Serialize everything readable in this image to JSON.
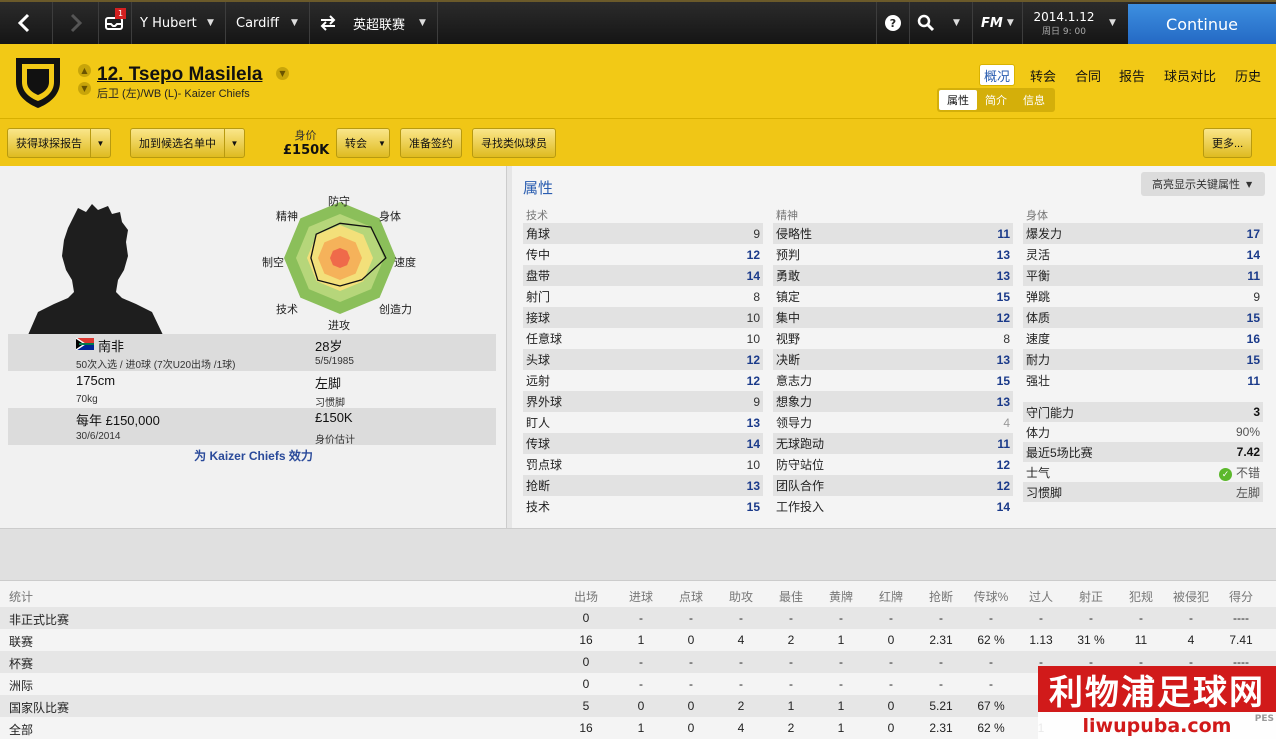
{
  "topbar": {
    "back_icon": "arrow-left-icon",
    "forward_icon": "arrow-right-icon",
    "inbox_badge": "1",
    "manager": "Y Hubert",
    "club": "Cardiff",
    "competition": "英超联赛",
    "logo": "FM",
    "date": "2014.1.12",
    "time": "周日 9: 00",
    "continue": "Continue"
  },
  "header": {
    "player_name": "12. Tsepo Masilela",
    "position": "后卫 (左)/WB (L)- Kaizer Chiefs",
    "tabs": [
      "概况",
      "转会",
      "合同",
      "报告",
      "球员对比",
      "历史"
    ],
    "subtabs": [
      "属性",
      "简介",
      "信息"
    ]
  },
  "actions": {
    "scout": "获得球探报告",
    "shortlist": "加到候选名单中",
    "value_label": "身价",
    "value": "£150K",
    "transfer": "转会",
    "contract": "准备签约",
    "similar": "寻找类似球员",
    "more": "更多..."
  },
  "radar": {
    "labels": [
      "防守",
      "身体",
      "速度",
      "创造力",
      "进攻",
      "技术",
      "制空",
      "精神"
    ],
    "colors": [
      "#8bbf5a",
      "#b6d67a",
      "#f3e07a",
      "#f5b25a",
      "#ef6a4a"
    ]
  },
  "profile": {
    "nation": "南非",
    "nation_flag": "south-africa-flag",
    "caps": "50次入选 / 进0球 (7次U20出场 /1球)",
    "age": "28岁",
    "dob": "5/5/1985",
    "height": "175cm",
    "foot": "左脚",
    "weight": "70kg",
    "foot_label": "习惯脚",
    "wage": "每年 £150,000",
    "value": "£150K",
    "contract_end": "30/6/2014",
    "value_label": "身价估计",
    "plays_for": "为 Kaizer Chiefs 效力"
  },
  "attributes": {
    "title": "属性",
    "highlight": "高亮显示关键属性",
    "technical_head": "技术",
    "technical": [
      {
        "name": "角球",
        "value": "9"
      },
      {
        "name": "传中",
        "value": "12"
      },
      {
        "name": "盘带",
        "value": "14"
      },
      {
        "name": "射门",
        "value": "8"
      },
      {
        "name": "接球",
        "value": "10"
      },
      {
        "name": "任意球",
        "value": "10"
      },
      {
        "name": "头球",
        "value": "12"
      },
      {
        "name": "远射",
        "value": "12"
      },
      {
        "name": "界外球",
        "value": "9"
      },
      {
        "name": "盯人",
        "value": "13"
      },
      {
        "name": "传球",
        "value": "14"
      },
      {
        "name": "罚点球",
        "value": "10"
      },
      {
        "name": "抢断",
        "value": "13"
      },
      {
        "name": "技术",
        "value": "15"
      }
    ],
    "mental_head": "精神",
    "mental": [
      {
        "name": "侵略性",
        "value": "11"
      },
      {
        "name": "预判",
        "value": "13"
      },
      {
        "name": "勇敢",
        "value": "13"
      },
      {
        "name": "镇定",
        "value": "15"
      },
      {
        "name": "集中",
        "value": "12"
      },
      {
        "name": "视野",
        "value": "8"
      },
      {
        "name": "决断",
        "value": "13"
      },
      {
        "name": "意志力",
        "value": "15"
      },
      {
        "name": "想象力",
        "value": "13"
      },
      {
        "name": "领导力",
        "value": "4"
      },
      {
        "name": "无球跑动",
        "value": "11"
      },
      {
        "name": "防守站位",
        "value": "12"
      },
      {
        "name": "团队合作",
        "value": "12"
      },
      {
        "name": "工作投入",
        "value": "14"
      }
    ],
    "physical_head": "身体",
    "physical": [
      {
        "name": "爆发力",
        "value": "17"
      },
      {
        "name": "灵活",
        "value": "14"
      },
      {
        "name": "平衡",
        "value": "11"
      },
      {
        "name": "弹跳",
        "value": "9"
      },
      {
        "name": "体质",
        "value": "15"
      },
      {
        "name": "速度",
        "value": "16"
      },
      {
        "name": "耐力",
        "value": "15"
      },
      {
        "name": "强壮",
        "value": "11"
      }
    ],
    "extra": [
      {
        "name": "守门能力",
        "value": "3"
      },
      {
        "name": "体力",
        "value": "90%"
      },
      {
        "name": "最近5场比赛",
        "value": "7.42"
      },
      {
        "name": "士气",
        "value": "不错"
      },
      {
        "name": "习惯脚",
        "value": "左脚"
      }
    ]
  },
  "stats": {
    "title": "统计",
    "columns": [
      "出场",
      "进球",
      "点球",
      "助攻",
      "最佳",
      "黄牌",
      "红牌",
      "抢断",
      "传球%",
      "过人",
      "射正",
      "犯规",
      "被侵犯",
      "得分"
    ],
    "rows": [
      {
        "name": "非正式比赛",
        "cells": [
          "0",
          "-",
          "-",
          "-",
          "-",
          "-",
          "-",
          "-",
          "-",
          "-",
          "-",
          "-",
          "-",
          "----"
        ]
      },
      {
        "name": "联赛",
        "cells": [
          "16",
          "1",
          "0",
          "4",
          "2",
          "1",
          "0",
          "2.31",
          "62 %",
          "1.13",
          "31 %",
          "11",
          "4",
          "7.41"
        ]
      },
      {
        "name": "杯赛",
        "cells": [
          "0",
          "-",
          "-",
          "-",
          "-",
          "-",
          "-",
          "-",
          "-",
          "-",
          "-",
          "-",
          "-",
          "----"
        ]
      },
      {
        "name": "洲际",
        "cells": [
          "0",
          "-",
          "-",
          "-",
          "-",
          "-",
          "-",
          "-",
          "-",
          "-",
          "-",
          "-",
          "-",
          "----"
        ]
      },
      {
        "name": "国家队比赛",
        "cells": [
          "5",
          "0",
          "0",
          "2",
          "1",
          "1",
          "0",
          "5.21",
          "67 %",
          "1",
          "",
          "",
          "",
          ""
        ]
      },
      {
        "name": "全部",
        "cells": [
          "16",
          "1",
          "0",
          "4",
          "2",
          "1",
          "0",
          "2.31",
          "62 %",
          "1",
          "",
          "",
          "",
          ""
        ]
      }
    ]
  },
  "watermark": {
    "cn": "利物浦足球网",
    "url": "liwupuba.com",
    "logo_text": "PES"
  }
}
